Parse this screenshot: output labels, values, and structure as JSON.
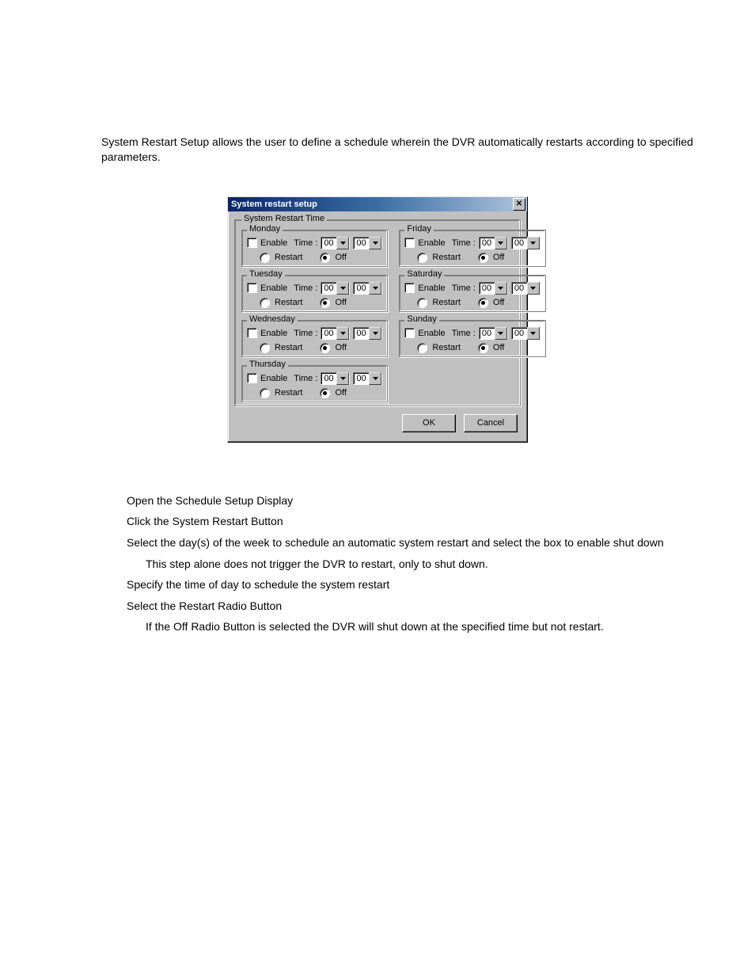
{
  "intro": "System Restart Setup allows the user to define a schedule wherein the DVR automatically restarts according to specified parameters.",
  "dialog": {
    "title": "System restart setup",
    "group_label": "System Restart Time",
    "enable_label": "Enable",
    "time_label": "Time :",
    "restart_label": "Restart",
    "off_label": "Off",
    "ok_label": "OK",
    "cancel_label": "Cancel",
    "hour_value": "00",
    "minute_value": "00",
    "days": {
      "monday": {
        "label": "Monday"
      },
      "tuesday": {
        "label": "Tuesday"
      },
      "wednesday": {
        "label": "Wednesday"
      },
      "thursday": {
        "label": "Thursday"
      },
      "friday": {
        "label": "Friday"
      },
      "saturday": {
        "label": "Saturday"
      },
      "sunday": {
        "label": "Sunday"
      }
    }
  },
  "instructions": {
    "s1": "Open the Schedule Setup Display",
    "s2": "Click the System Restart Button",
    "s3": "Select the day(s) of the week to schedule an automatic system restart and select the box to enable shut down",
    "s3a": "This step alone does not trigger the DVR to restart, only to shut down.",
    "s4": "Specify the time of day to schedule the system restart",
    "s5": "Select the Restart Radio Button",
    "s5a": "If the Off Radio Button is selected the DVR will shut down at the specified time but not restart."
  }
}
